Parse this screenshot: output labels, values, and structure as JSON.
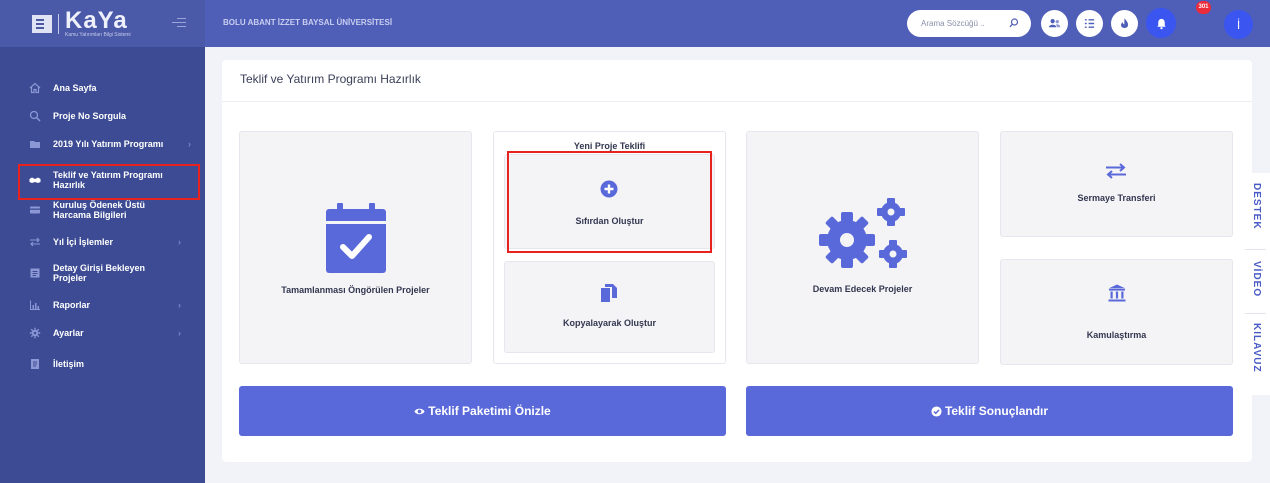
{
  "brand": {
    "title": "KaYa",
    "subtitle": "Kamu Yatırımları Bilgi Sistemi"
  },
  "header": {
    "university": "BOLU ABANT İZZET BAYSAL ÜNİVERSİTESİ",
    "search_placeholder": "Arama Sözcüğü ..",
    "notification_count": "301",
    "avatar_initial": "İ"
  },
  "sidebar": {
    "items": [
      {
        "label": "Ana Sayfa",
        "icon": "home-icon"
      },
      {
        "label": "Proje No Sorgula",
        "icon": "search-icon"
      },
      {
        "label": "2019 Yılı Yatırım Programı",
        "icon": "folder-icon",
        "chevron": "›"
      },
      {
        "label": "Teklif ve Yatırım Programı Hazırlık",
        "icon": "handshake-icon",
        "active": true
      },
      {
        "label": "Kuruluş Ödenek Üstü Harcama Bilgileri",
        "icon": "card-icon"
      },
      {
        "label": "Yıl İçi İşlemler",
        "icon": "transfer-icon",
        "chevron": "›"
      },
      {
        "label": "Detay Girişi Bekleyen Projeler",
        "icon": "list-icon"
      },
      {
        "label": "Raporlar",
        "icon": "chart-icon",
        "chevron": "›"
      },
      {
        "label": "Ayarlar",
        "icon": "gear-icon",
        "chevron": "›"
      },
      {
        "label": "İletişim",
        "icon": "contact-icon"
      }
    ]
  },
  "main": {
    "title": "Teklif ve Yatırım Programı Hazırlık",
    "tiles": {
      "completed": "Tamamlanması Öngörülen Projeler",
      "new_group_title": "Yeni Proje Teklifi",
      "create_scratch": "Sıfırdan Oluştur",
      "create_copy": "Kopyalayarak Oluştur",
      "ongoing": "Devam Edecek Projeler",
      "capital_transfer": "Sermaye Transferi",
      "expropriation": "Kamulaştırma"
    },
    "actions": {
      "preview": "Teklif Paketimi Önizle",
      "finalize": "Teklif Sonuçlandır"
    }
  },
  "side_tabs": [
    "DESTEK",
    "VİDEO",
    "KILAVUZ"
  ],
  "colors": {
    "sidebar": "#3c4b93",
    "header": "#4f5fb8",
    "accent": "#5a69d9",
    "highlight": "#e8231f"
  }
}
